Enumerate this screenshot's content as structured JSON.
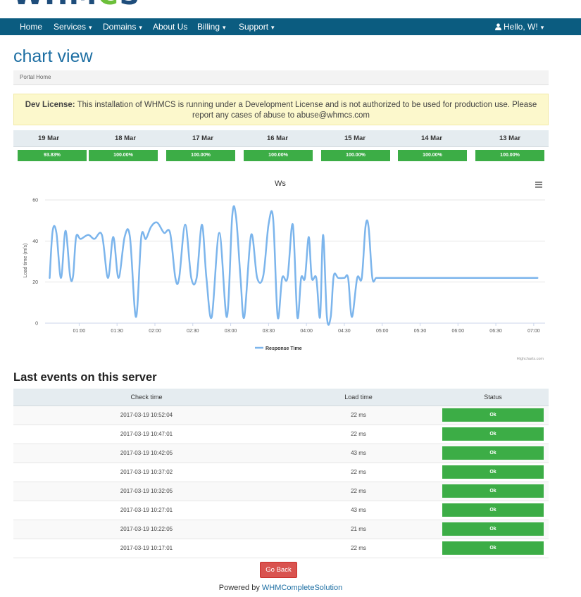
{
  "logo": {
    "text_a": "WHM",
    "text_b": "C",
    "text_c": "S"
  },
  "nav": {
    "home": "Home",
    "services": "Services",
    "domains": "Domains",
    "about": "About Us",
    "billing": "Billing",
    "support": "Support",
    "user": "Hello, W!"
  },
  "page": {
    "title": "chart view"
  },
  "breadcrumb": {
    "home": "Portal Home"
  },
  "alert": {
    "label": "Dev License:",
    "text": "This installation of WHMCS is running under a Development License and is not authorized to be used for production use. Please report any cases of abuse to abuse@whmcs.com"
  },
  "uptime": [
    {
      "day": "19 Mar",
      "value": "93.83%"
    },
    {
      "day": "18 Mar",
      "value": "100.00%"
    },
    {
      "day": "17 Mar",
      "value": "100.00%"
    },
    {
      "day": "16 Mar",
      "value": "100.00%"
    },
    {
      "day": "15 Mar",
      "value": "100.00%"
    },
    {
      "day": "14 Mar",
      "value": "100.00%"
    },
    {
      "day": "13 Mar",
      "value": "100.00%"
    }
  ],
  "chart_data": {
    "type": "line",
    "title": "Ws",
    "ylabel": "Load time (m/s)",
    "xlabel": "",
    "ylim": [
      0,
      60
    ],
    "yticks": [
      0,
      20,
      40,
      60
    ],
    "xticks": [
      "01:00",
      "01:30",
      "02:00",
      "02:30",
      "03:00",
      "03:30",
      "04:00",
      "04:30",
      "05:00",
      "05:30",
      "06:00",
      "06:30",
      "07:00"
    ],
    "xrange_hours": [
      0.55,
      7.15
    ],
    "legend": "bottom-center",
    "credits": "Highcharts.com",
    "color": "#7cb5ec",
    "series": [
      {
        "name": "Response Time",
        "x": [
          0.61,
          0.65,
          0.7,
          0.76,
          0.82,
          0.88,
          0.92,
          0.96,
          1.02,
          1.12,
          1.2,
          1.3,
          1.38,
          1.45,
          1.52,
          1.6,
          1.67,
          1.75,
          1.82,
          1.88,
          1.95,
          2.03,
          2.12,
          2.2,
          2.27,
          2.32,
          2.4,
          2.48,
          2.55,
          2.62,
          2.68,
          2.75,
          2.85,
          2.95,
          3.02,
          3.07,
          3.13,
          3.18,
          3.27,
          3.35,
          3.43,
          3.5,
          3.56,
          3.62,
          3.68,
          3.75,
          3.82,
          3.88,
          3.93,
          3.98,
          4.03,
          4.07,
          4.13,
          4.18,
          4.22,
          4.27,
          4.32,
          4.36,
          4.42,
          4.5,
          4.55,
          4.6,
          4.67,
          4.73,
          4.78,
          4.82,
          4.87,
          4.92,
          4.98,
          5.03,
          5.07,
          5.12,
          5.18,
          5.25,
          5.33,
          5.38,
          5.43,
          5.48,
          5.55,
          5.63,
          5.68,
          5.75,
          5.82,
          5.88,
          5.93,
          5.98,
          6.05,
          6.13,
          6.22,
          6.32,
          6.43,
          6.53,
          6.6,
          6.68,
          6.73,
          6.78,
          6.88,
          6.95,
          7.0,
          7.05
        ]
      }
    ],
    "y": [
      22,
      45,
      44,
      22,
      45,
      23,
      23,
      42,
      41,
      43,
      41,
      43,
      22,
      42,
      22,
      42,
      42,
      3,
      42,
      41,
      47,
      49,
      44,
      44,
      22,
      22,
      48,
      22,
      22,
      48,
      22,
      3,
      44,
      3,
      52,
      52,
      22,
      3,
      43,
      22,
      23,
      48,
      51,
      3,
      22,
      22,
      48,
      3,
      22,
      22,
      42,
      22,
      22,
      3,
      43,
      3,
      3,
      23,
      22,
      22,
      22,
      3,
      22,
      22,
      47,
      47,
      22,
      22,
      22,
      22,
      22,
      22,
      22,
      22,
      22,
      22,
      22,
      22,
      22,
      22,
      22,
      22,
      22,
      22,
      22,
      22,
      22,
      22,
      22,
      22,
      22,
      22,
      22,
      22,
      22,
      22,
      22,
      22,
      22,
      22
    ]
  },
  "events": {
    "title": "Last events on this server",
    "headers": [
      "Check time",
      "Load time",
      "Status"
    ],
    "rows": [
      {
        "time": "2017-03-19 10:52:04",
        "load": "22 ms",
        "status": "Ok"
      },
      {
        "time": "2017-03-19 10:47:01",
        "load": "22 ms",
        "status": "Ok"
      },
      {
        "time": "2017-03-19 10:42:05",
        "load": "43 ms",
        "status": "Ok"
      },
      {
        "time": "2017-03-19 10:37:02",
        "load": "22 ms",
        "status": "Ok"
      },
      {
        "time": "2017-03-19 10:32:05",
        "load": "22 ms",
        "status": "Ok"
      },
      {
        "time": "2017-03-19 10:27:01",
        "load": "43 ms",
        "status": "Ok"
      },
      {
        "time": "2017-03-19 10:22:05",
        "load": "21 ms",
        "status": "Ok"
      },
      {
        "time": "2017-03-19 10:17:01",
        "load": "22 ms",
        "status": "Ok"
      }
    ]
  },
  "buttons": {
    "go_back": "Go Back"
  },
  "footer": {
    "prefix": "Powered by",
    "link": "WHMCompleteSolution"
  }
}
